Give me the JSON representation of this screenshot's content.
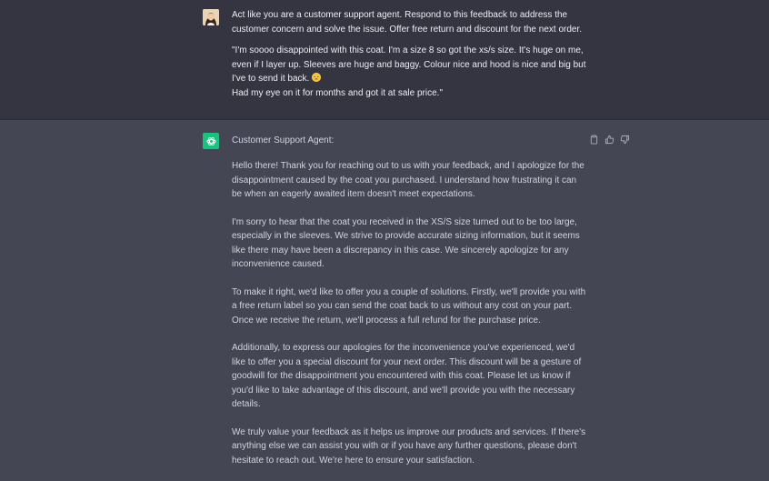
{
  "user": {
    "avatar_icon": "user-avatar-photo",
    "paragraphs": [
      "Act like you are a customer support agent. Respond to this feedback to address the customer concern and solve the issue. Offer free return and discount for the next order.",
      "\"I'm soooo disappointed with this coat. I'm a size 8 so got the xs/s size. It's huge on me, even if I layer up. Sleeves are huge and baggy. Colour nice and hood is nice and big but I've to send it back.",
      "Had my eye on it for months and got it at sale price.\""
    ],
    "emoji": "pensive-face-emoji"
  },
  "assistant": {
    "avatar_icon": "openai-logo-icon",
    "header": "Customer Support Agent:",
    "paragraphs": [
      "Hello there! Thank you for reaching out to us with your feedback, and I apologize for the disappointment caused by the coat you purchased. I understand how frustrating it can be when an eagerly awaited item doesn't meet expectations.",
      "I'm sorry to hear that the coat you received in the XS/S size turned out to be too large, especially in the sleeves. We strive to provide accurate sizing information, but it seems like there may have been a discrepancy in this case. We sincerely apologize for any inconvenience caused.",
      "To make it right, we'd like to offer you a couple of solutions. Firstly, we'll provide you with a free return label so you can send the coat back to us without any cost on your part. Once we receive the return, we'll process a full refund for the purchase price.",
      "Additionally, to express our apologies for the inconvenience you've experienced, we'd like to offer you a special discount for your next order. This discount will be a gesture of goodwill for the disappointment you encountered with this coat. Please let us know if you'd like to take advantage of this discount, and we'll provide you with the necessary details.",
      "We truly value your feedback as it helps us improve our products and services. If there's anything else we can assist you with or if you have any further questions, please don't hesitate to reach out. We're here to ensure your satisfaction."
    ],
    "actions": [
      "copy-icon",
      "thumbs-up-icon",
      "thumbs-down-icon"
    ]
  },
  "colors": {
    "user_bg": "#343541",
    "assistant_bg": "#444654",
    "bot_avatar": "#19c37d"
  }
}
